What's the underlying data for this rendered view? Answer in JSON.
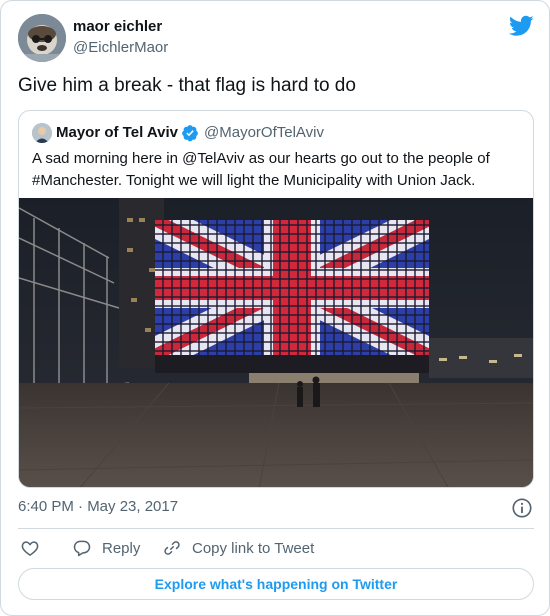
{
  "tweet": {
    "author_name": "maor eichler",
    "author_handle": "@EichlerMaor",
    "text": "Give him a break - that flag is hard to do",
    "timestamp": "6:40 PM · May 23, 2017"
  },
  "quoted_tweet": {
    "author_name": "Mayor of Tel Aviv",
    "author_handle": "@MayorOfTelAviv",
    "verified": true,
    "text_1": "A sad morning here in ",
    "mention": "@TelAviv",
    "text_2": " as our hearts go out to the people of ",
    "hashtag": "#Manchester",
    "text_3": ". Tonight we will light the Municipality with Union Jack."
  },
  "actions": {
    "reply_label": "Reply",
    "copy_label": "Copy link to Tweet"
  },
  "explore_label": "Explore what's happening on Twitter",
  "colors": {
    "accent": "#1d9bf0",
    "text_secondary": "#536471",
    "border": "#cfd9de"
  },
  "icons": [
    "twitter-bird-icon",
    "verified-badge-icon",
    "info-icon",
    "heart-icon",
    "reply-bubble-icon",
    "link-icon"
  ]
}
